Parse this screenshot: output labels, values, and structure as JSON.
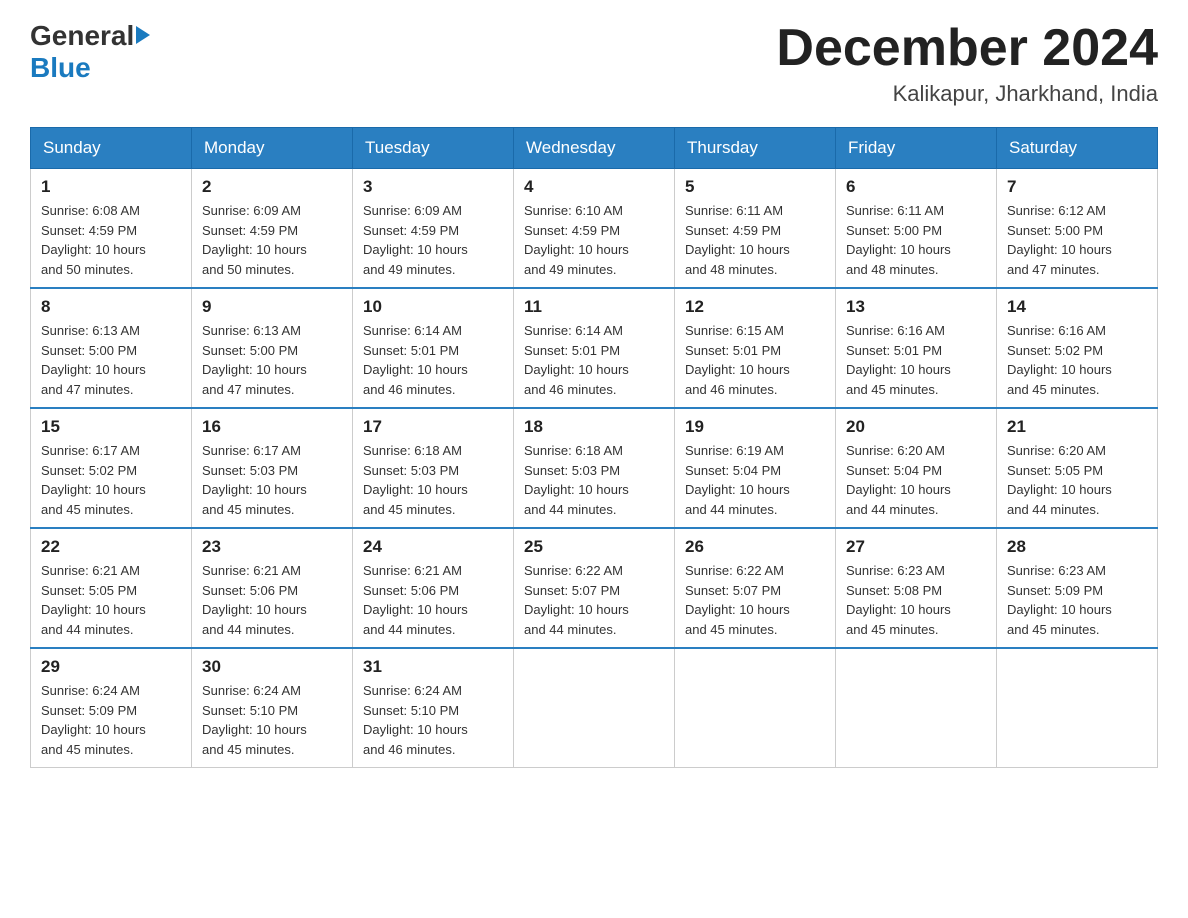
{
  "header": {
    "logo_general": "General",
    "logo_blue": "Blue",
    "month_title": "December 2024",
    "location": "Kalikapur, Jharkhand, India"
  },
  "weekdays": [
    "Sunday",
    "Monday",
    "Tuesday",
    "Wednesday",
    "Thursday",
    "Friday",
    "Saturday"
  ],
  "weeks": [
    [
      {
        "day": "1",
        "info": "Sunrise: 6:08 AM\nSunset: 4:59 PM\nDaylight: 10 hours\nand 50 minutes."
      },
      {
        "day": "2",
        "info": "Sunrise: 6:09 AM\nSunset: 4:59 PM\nDaylight: 10 hours\nand 50 minutes."
      },
      {
        "day": "3",
        "info": "Sunrise: 6:09 AM\nSunset: 4:59 PM\nDaylight: 10 hours\nand 49 minutes."
      },
      {
        "day": "4",
        "info": "Sunrise: 6:10 AM\nSunset: 4:59 PM\nDaylight: 10 hours\nand 49 minutes."
      },
      {
        "day": "5",
        "info": "Sunrise: 6:11 AM\nSunset: 4:59 PM\nDaylight: 10 hours\nand 48 minutes."
      },
      {
        "day": "6",
        "info": "Sunrise: 6:11 AM\nSunset: 5:00 PM\nDaylight: 10 hours\nand 48 minutes."
      },
      {
        "day": "7",
        "info": "Sunrise: 6:12 AM\nSunset: 5:00 PM\nDaylight: 10 hours\nand 47 minutes."
      }
    ],
    [
      {
        "day": "8",
        "info": "Sunrise: 6:13 AM\nSunset: 5:00 PM\nDaylight: 10 hours\nand 47 minutes."
      },
      {
        "day": "9",
        "info": "Sunrise: 6:13 AM\nSunset: 5:00 PM\nDaylight: 10 hours\nand 47 minutes."
      },
      {
        "day": "10",
        "info": "Sunrise: 6:14 AM\nSunset: 5:01 PM\nDaylight: 10 hours\nand 46 minutes."
      },
      {
        "day": "11",
        "info": "Sunrise: 6:14 AM\nSunset: 5:01 PM\nDaylight: 10 hours\nand 46 minutes."
      },
      {
        "day": "12",
        "info": "Sunrise: 6:15 AM\nSunset: 5:01 PM\nDaylight: 10 hours\nand 46 minutes."
      },
      {
        "day": "13",
        "info": "Sunrise: 6:16 AM\nSunset: 5:01 PM\nDaylight: 10 hours\nand 45 minutes."
      },
      {
        "day": "14",
        "info": "Sunrise: 6:16 AM\nSunset: 5:02 PM\nDaylight: 10 hours\nand 45 minutes."
      }
    ],
    [
      {
        "day": "15",
        "info": "Sunrise: 6:17 AM\nSunset: 5:02 PM\nDaylight: 10 hours\nand 45 minutes."
      },
      {
        "day": "16",
        "info": "Sunrise: 6:17 AM\nSunset: 5:03 PM\nDaylight: 10 hours\nand 45 minutes."
      },
      {
        "day": "17",
        "info": "Sunrise: 6:18 AM\nSunset: 5:03 PM\nDaylight: 10 hours\nand 45 minutes."
      },
      {
        "day": "18",
        "info": "Sunrise: 6:18 AM\nSunset: 5:03 PM\nDaylight: 10 hours\nand 44 minutes."
      },
      {
        "day": "19",
        "info": "Sunrise: 6:19 AM\nSunset: 5:04 PM\nDaylight: 10 hours\nand 44 minutes."
      },
      {
        "day": "20",
        "info": "Sunrise: 6:20 AM\nSunset: 5:04 PM\nDaylight: 10 hours\nand 44 minutes."
      },
      {
        "day": "21",
        "info": "Sunrise: 6:20 AM\nSunset: 5:05 PM\nDaylight: 10 hours\nand 44 minutes."
      }
    ],
    [
      {
        "day": "22",
        "info": "Sunrise: 6:21 AM\nSunset: 5:05 PM\nDaylight: 10 hours\nand 44 minutes."
      },
      {
        "day": "23",
        "info": "Sunrise: 6:21 AM\nSunset: 5:06 PM\nDaylight: 10 hours\nand 44 minutes."
      },
      {
        "day": "24",
        "info": "Sunrise: 6:21 AM\nSunset: 5:06 PM\nDaylight: 10 hours\nand 44 minutes."
      },
      {
        "day": "25",
        "info": "Sunrise: 6:22 AM\nSunset: 5:07 PM\nDaylight: 10 hours\nand 44 minutes."
      },
      {
        "day": "26",
        "info": "Sunrise: 6:22 AM\nSunset: 5:07 PM\nDaylight: 10 hours\nand 45 minutes."
      },
      {
        "day": "27",
        "info": "Sunrise: 6:23 AM\nSunset: 5:08 PM\nDaylight: 10 hours\nand 45 minutes."
      },
      {
        "day": "28",
        "info": "Sunrise: 6:23 AM\nSunset: 5:09 PM\nDaylight: 10 hours\nand 45 minutes."
      }
    ],
    [
      {
        "day": "29",
        "info": "Sunrise: 6:24 AM\nSunset: 5:09 PM\nDaylight: 10 hours\nand 45 minutes."
      },
      {
        "day": "30",
        "info": "Sunrise: 6:24 AM\nSunset: 5:10 PM\nDaylight: 10 hours\nand 45 minutes."
      },
      {
        "day": "31",
        "info": "Sunrise: 6:24 AM\nSunset: 5:10 PM\nDaylight: 10 hours\nand 46 minutes."
      },
      {
        "day": "",
        "info": ""
      },
      {
        "day": "",
        "info": ""
      },
      {
        "day": "",
        "info": ""
      },
      {
        "day": "",
        "info": ""
      }
    ]
  ]
}
